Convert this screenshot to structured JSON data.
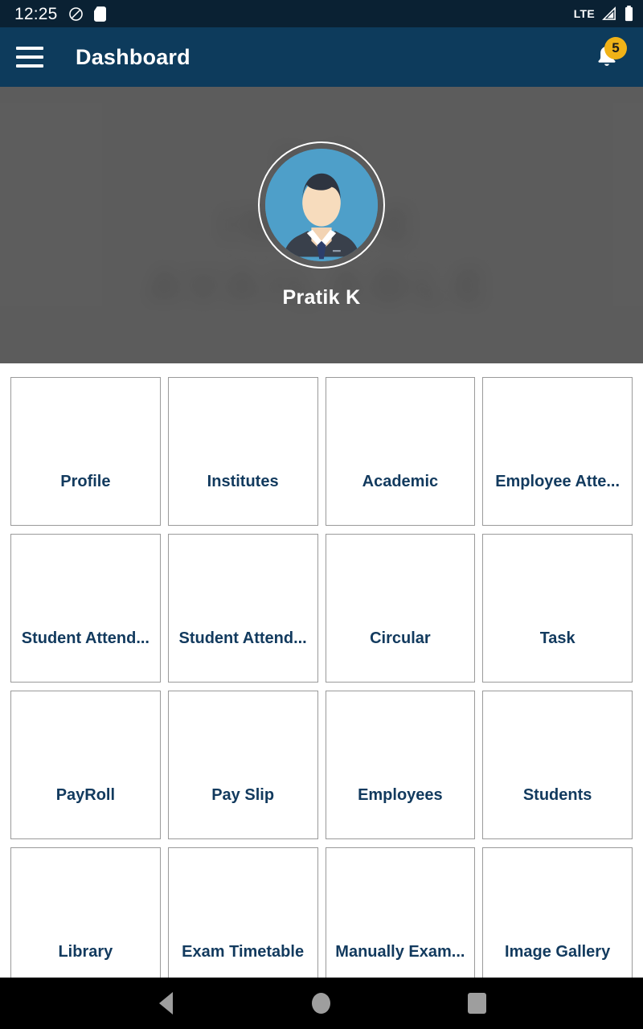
{
  "status_bar": {
    "time": "12:25",
    "icons_left": [
      "dnd-icon",
      "sd-card-icon"
    ],
    "network_label": "LTE",
    "icons_right": [
      "signal-icon",
      "battery-icon"
    ],
    "background_color": "#0a2133"
  },
  "app_bar": {
    "menu_icon": "hamburger-menu-icon",
    "title": "Dashboard",
    "notification_icon": "bell-icon",
    "notification_count": "5",
    "badge_color": "#f0b217",
    "background_color": "#0d3b5c"
  },
  "profile_header": {
    "background_text_lines": [
      "NO",
      "IMAGE",
      "AVAILABLE"
    ],
    "avatar_icon": "user-avatar-icon",
    "name": "Pratik K",
    "background_color": "#5e5e5e"
  },
  "grid": {
    "tiles": [
      {
        "label": "Profile"
      },
      {
        "label": "Institutes"
      },
      {
        "label": "Academic"
      },
      {
        "label": "Employee Atte..."
      },
      {
        "label": "Student Attend..."
      },
      {
        "label": "Student Attend..."
      },
      {
        "label": "Circular"
      },
      {
        "label": "Task"
      },
      {
        "label": "PayRoll"
      },
      {
        "label": "Pay Slip"
      },
      {
        "label": "Employees"
      },
      {
        "label": "Students"
      },
      {
        "label": "Library"
      },
      {
        "label": "Exam Timetable"
      },
      {
        "label": "Manually Exam..."
      },
      {
        "label": "Image Gallery"
      }
    ],
    "label_color": "#123a5e"
  },
  "nav_bar": {
    "buttons": [
      "back-icon",
      "home-icon",
      "recents-icon"
    ],
    "background_color": "#000000"
  }
}
